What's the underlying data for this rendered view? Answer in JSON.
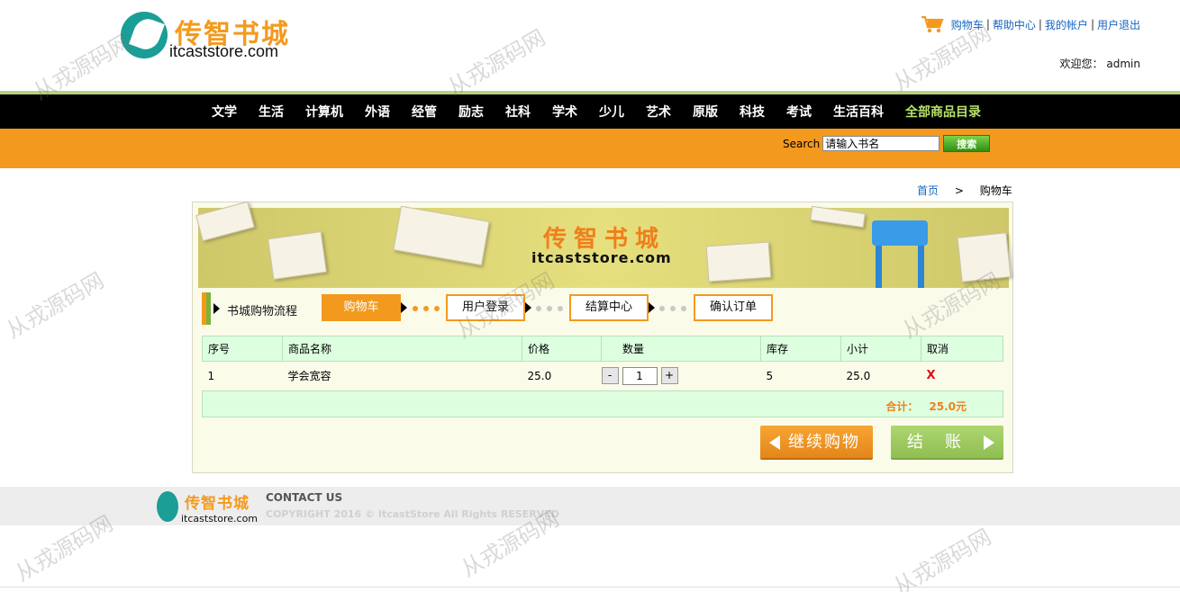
{
  "logo": {
    "cn": "传智书城",
    "en": "itcaststore.com"
  },
  "toplinks": {
    "cart": "购物车",
    "help": "帮助中心",
    "account": "我的帐户",
    "logout": "用户退出",
    "sep": "|"
  },
  "welcome": {
    "label": "欢迎您：",
    "user": "admin"
  },
  "nav": {
    "items": [
      "文学",
      "生活",
      "计算机",
      "外语",
      "经管",
      "励志",
      "社科",
      "学术",
      "少儿",
      "艺术",
      "原版",
      "科技",
      "考试",
      "生活百科"
    ],
    "all": "全部商品目录"
  },
  "search": {
    "label": "Search",
    "value": "请输入书名",
    "button": "搜索"
  },
  "breadcrumb": {
    "home": "首页",
    "sep": ">",
    "current": "购物车"
  },
  "banner": {
    "cn": "传智书城",
    "en": "itcaststore.com"
  },
  "flow": {
    "title": "书城购物流程",
    "steps": [
      "购物车",
      "用户登录",
      "结算中心",
      "确认订单"
    ]
  },
  "cart": {
    "headers": [
      "序号",
      "商品名称",
      "价格",
      "数量",
      "库存",
      "小计",
      "取消"
    ],
    "rows": [
      {
        "no": "1",
        "name": "学会宽容",
        "price": "25.0",
        "qty": "1",
        "stock": "5",
        "subtotal": "25.0",
        "remove": "X"
      }
    ],
    "qty_minus": "-",
    "qty_plus": "+",
    "total_label": "合计：",
    "total_value": "25.0元"
  },
  "buttons": {
    "continue": "继续购物",
    "checkout": "结账"
  },
  "footer": {
    "logo_cn": "传智书城",
    "logo_en": "itcaststore.com",
    "contact": "CONTACT US",
    "copyright": "COPYRIGHT 2016 © ItcastStore All Rights RESERVED"
  },
  "watermark": "从戎源码网",
  "colors": {
    "orange": "#f39a1e",
    "green_bar": "#b7d17a",
    "nav_bg": "#000000",
    "link": "#1566c0",
    "table_head": "#ddffe0",
    "remove": "#e01010"
  }
}
